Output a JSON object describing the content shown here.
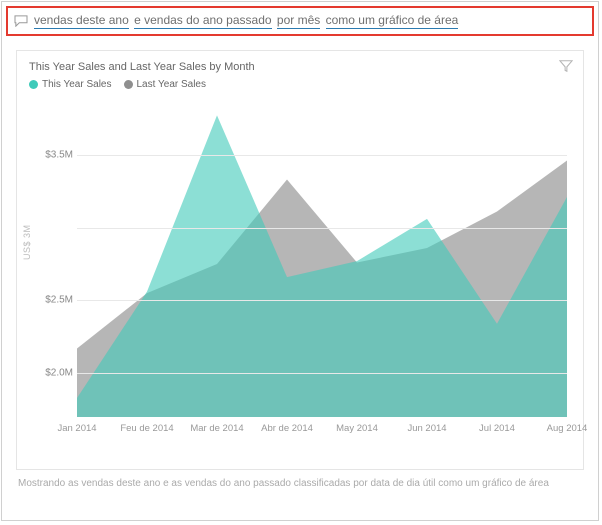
{
  "qa": {
    "segments": [
      "vendas deste ano",
      "e vendas do ano passado",
      "por mês",
      "como um gráfico de área"
    ]
  },
  "chart": {
    "title": "This Year Sales and Last Year Sales by Month",
    "legend_this": "This Year Sales",
    "legend_last": "Last Year Sales",
    "y_axis_title": "US$ 3M",
    "colors": {
      "this_year": "#3fcab9",
      "last_year": "#8f8f8f"
    }
  },
  "chart_data": {
    "type": "area",
    "categories": [
      "Jan 2014",
      "Feu de 2014",
      "Mar de 2014",
      "Abr de 2014",
      "May 2014",
      "Jun 2014",
      "Jul 2014",
      "Aug 2014"
    ],
    "series": [
      {
        "name": "This Year Sales",
        "values": [
          1830000,
          2560000,
          3770000,
          2660000,
          2770000,
          3060000,
          2340000,
          3210000
        ]
      },
      {
        "name": "Last Year Sales",
        "values": [
          2170000,
          2550000,
          2750000,
          3330000,
          2760000,
          2860000,
          3110000,
          3460000
        ]
      }
    ],
    "ylim": [
      1700000,
      3800000
    ],
    "y_ticks": [
      2000000,
      2500000,
      3000000,
      3500000
    ],
    "y_tick_labels": [
      "$2.0M",
      "$2.5M",
      "",
      "$3.5M"
    ],
    "title": "This Year Sales and Last Year Sales by Month",
    "xlabel": "",
    "ylabel": "US$"
  },
  "footer": {
    "text": "Mostrando as vendas deste ano e as vendas do ano passado classificadas por data de dia útil como um gráfico de área"
  }
}
